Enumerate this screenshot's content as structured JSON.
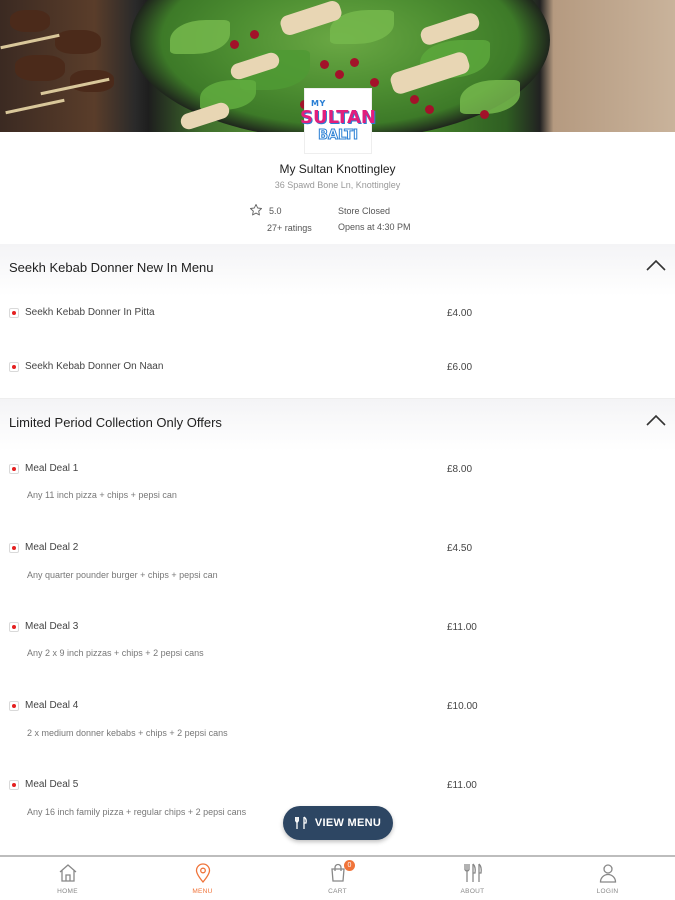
{
  "store": {
    "logo_line1": "MY",
    "logo_line2": "SULTAN",
    "logo_line3": "BALTI",
    "name": "My Sultan Knottingley",
    "address": "36 Spawd Bone Ln, Knottingley",
    "rating": "5.0",
    "ratings_count": "27+ ratings",
    "status": "Store Closed",
    "opens": "Opens at 4:30 PM"
  },
  "sections": [
    {
      "title": "Seekh Kebab Donner New In Menu",
      "items": [
        {
          "name": "Seekh Kebab Donner In Pitta",
          "price": "£4.00"
        },
        {
          "name": "Seekh Kebab Donner On Naan",
          "price": "£6.00"
        }
      ]
    },
    {
      "title": "Limited Period Collection Only Offers",
      "items": [
        {
          "name": "Meal Deal 1",
          "price": "£8.00",
          "desc": "Any 11 inch pizza + chips + pepsi can"
        },
        {
          "name": "Meal Deal 2",
          "price": "£4.50",
          "desc": "Any quarter pounder burger + chips + pepsi can"
        },
        {
          "name": "Meal Deal 3",
          "price": "£11.00",
          "desc": "Any 2 x 9 inch pizzas + chips + 2 pepsi cans"
        },
        {
          "name": "Meal Deal 4",
          "price": "£10.00",
          "desc": "2 x medium donner kebabs + chips + 2 pepsi cans"
        },
        {
          "name": "Meal Deal 5",
          "price": "£11.00",
          "desc": "Any 16 inch family pizza + regular chips + 2 pepsi cans"
        }
      ]
    }
  ],
  "view_menu_label": "VIEW MENU",
  "tabs": [
    {
      "label": "HOME",
      "icon": "home-icon"
    },
    {
      "label": "MENU",
      "icon": "location-pin-icon",
      "active": true
    },
    {
      "label": "CART",
      "icon": "shopping-bag-icon",
      "badge": "0"
    },
    {
      "label": "ABOUT",
      "icon": "cutlery-icon"
    },
    {
      "label": "LOGIN",
      "icon": "user-icon"
    }
  ],
  "colors": {
    "accent": "#f0743a",
    "button": "#2d4663",
    "item_marker": "#e52020"
  }
}
